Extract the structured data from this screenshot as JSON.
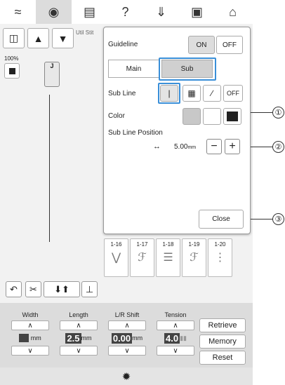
{
  "topbar": {
    "icons": [
      "wifi-icon",
      "camera-icon",
      "document-icon",
      "help-icon",
      "stitch-icon",
      "lock-icon",
      "home-icon"
    ]
  },
  "left": {
    "zoom_label": "100%",
    "util_label": "Util Stit",
    "foot_letter": "J"
  },
  "dialog": {
    "guideline_label": "Guideline",
    "guideline_on": "ON",
    "guideline_off": "OFF",
    "tab_main": "Main",
    "tab_sub": "Sub",
    "sub_line_label": "Sub Line",
    "sub_line_off": "OFF",
    "color_label": "Color",
    "sub_line_position_label": "Sub Line Position",
    "position_value": "5.00",
    "position_unit": "mm",
    "close_label": "Close"
  },
  "stitches": [
    {
      "code": "1-16"
    },
    {
      "code": "1-17"
    },
    {
      "code": "1-18"
    },
    {
      "code": "1-19"
    },
    {
      "code": "1-20"
    }
  ],
  "bottom": {
    "width_label": "Width",
    "width_unit": "mm",
    "length_label": "Length",
    "length_value": "2.5",
    "length_unit": "mm",
    "lr_label": "L/R Shift",
    "lr_value": "0.00",
    "lr_unit": "mm",
    "tension_label": "Tension",
    "tension_value": "4.0",
    "retrieve_label": "Retrieve",
    "memory_label": "Memory",
    "reset_label": "Reset"
  },
  "callouts": [
    "①",
    "②",
    "③"
  ],
  "colors": {
    "highlight": "#3a8fd8",
    "swatch_gray": "#c8c8c8",
    "swatch_white": "#ffffff",
    "swatch_black": "#222222"
  }
}
